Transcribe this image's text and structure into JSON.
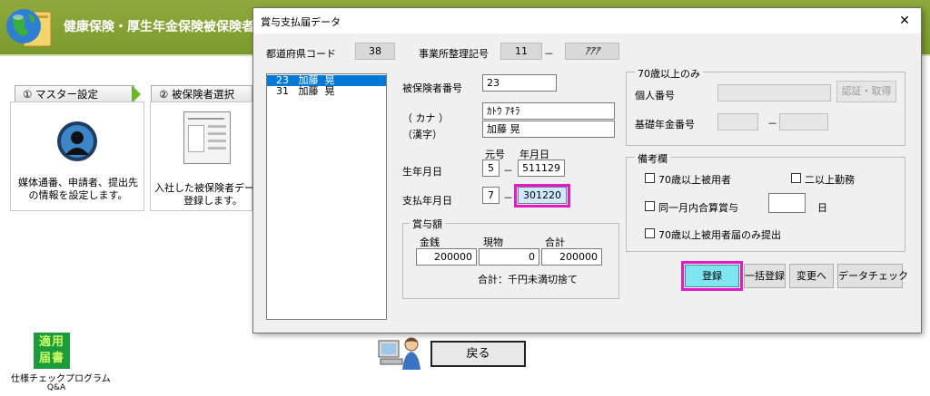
{
  "app": {
    "title": "健康保険・厚生年金保険被保険者賞",
    "steps": [
      {
        "label": "① マスター設定",
        "desc_lines": [
          "媒体通番、申請者、提出先",
          "の情報を設定します。"
        ]
      },
      {
        "label": "② 被保険者選択",
        "desc_lines": [
          "入社した被保険者デー",
          "登録します。"
        ]
      }
    ],
    "back_button": "戻る",
    "tekiyo_icon_text": [
      "適用",
      "届書"
    ],
    "bottom_left_lines": [
      "仕様チェックプログラム",
      "Q&A"
    ]
  },
  "dialog": {
    "title": "賞与支払届データ",
    "close_glyph": "✕",
    "prefecture_code_label": "都道府県コード",
    "prefecture_code": "38",
    "office_number_label": "事業所整理記号",
    "office_number_1": "11",
    "office_number_sep": "－",
    "office_number_2": "ｱｱｱ",
    "employees": [
      {
        "text": "23   加藤  晃",
        "selected": true
      },
      {
        "text": "31   加藤  晃",
        "selected": false
      }
    ],
    "insured_number_label": "被保険者番号",
    "insured_number": "23",
    "kana_label": "（ カナ ）",
    "kana_value": "ｶﾄｳ ｱｷﾗ",
    "kanji_label": "（漢字）",
    "kanji_value": "加藤  晃",
    "era_label": "元号",
    "ymd_label": "年月日",
    "birth_label": "生年月日",
    "birth_era": "5",
    "birth_date": "511129",
    "pay_label": "支払年月日",
    "pay_era": "7",
    "pay_date": "301220",
    "dash": "－",
    "bonus": {
      "caption": "賞与額",
      "cash_label": "金銭",
      "kind_label": "現物",
      "total_label": "合計",
      "cash": "200000",
      "kind": "0",
      "total": "200000",
      "note": "合計：千円未満切捨て"
    },
    "over70": {
      "caption": "70歳以上のみ",
      "personal_number_label": "個人番号",
      "auth_button": "認証・取得",
      "pension_number_label": "基礎年金番号",
      "pension_sep": "－"
    },
    "remarks": {
      "caption": "備考欄",
      "over70_insured": "70歳以上被用者",
      "multiple_work": "二以上勤務",
      "same_month": "同一月内合算賞与",
      "day_unit": "日",
      "over70_only": "70歳以上被用者届のみ提出"
    },
    "buttons": {
      "register": "登録",
      "bulk_register": "一括登録",
      "change": "変更へ",
      "data_check": "データチェック"
    }
  },
  "colors": {
    "header_green": "#8faa3c",
    "selection_blue": "#0078d7",
    "highlight_magenta": "#e619c8",
    "register_button": "#7fe5f0"
  }
}
